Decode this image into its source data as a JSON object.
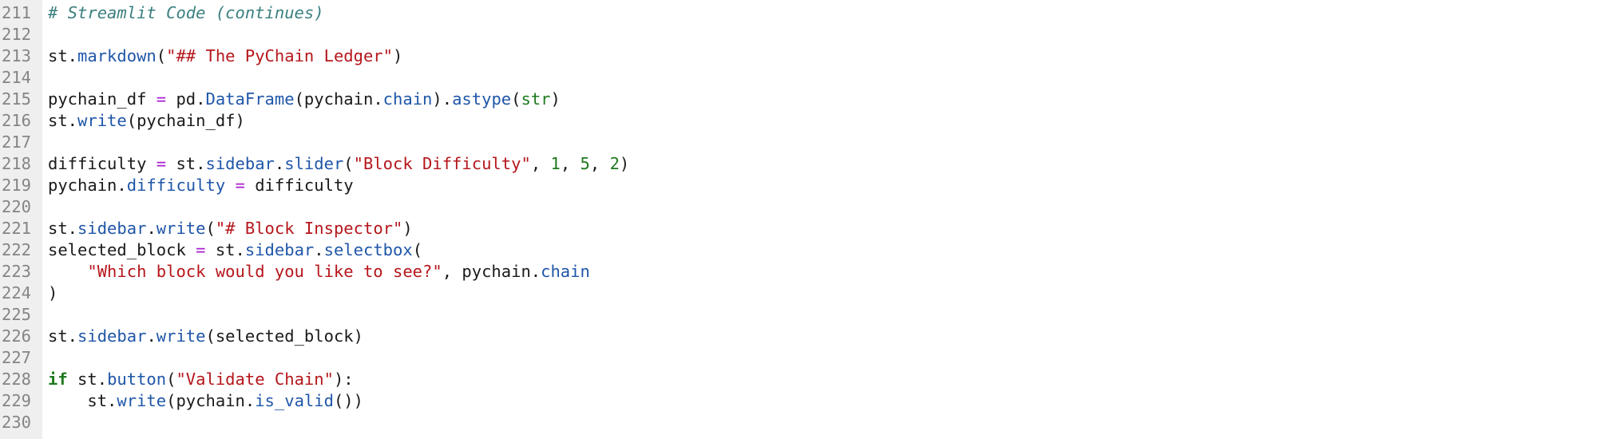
{
  "editor": {
    "lines": [
      {
        "number": "211",
        "tokens": [
          {
            "t": "# Streamlit Code (continues)",
            "k": "comment"
          }
        ]
      },
      {
        "number": "212",
        "tokens": []
      },
      {
        "number": "213",
        "tokens": [
          {
            "t": "st.",
            "k": "default"
          },
          {
            "t": "markdown",
            "k": "attr"
          },
          {
            "t": "(",
            "k": "default"
          },
          {
            "t": "\"## The PyChain Ledger\"",
            "k": "string"
          },
          {
            "t": ")",
            "k": "default"
          }
        ]
      },
      {
        "number": "214",
        "tokens": []
      },
      {
        "number": "215",
        "tokens": [
          {
            "t": "pychain_df ",
            "k": "default"
          },
          {
            "t": "=",
            "k": "op"
          },
          {
            "t": " pd.",
            "k": "default"
          },
          {
            "t": "DataFrame",
            "k": "attr"
          },
          {
            "t": "(pychain.",
            "k": "default"
          },
          {
            "t": "chain",
            "k": "attr"
          },
          {
            "t": ").",
            "k": "default"
          },
          {
            "t": "astype",
            "k": "attr"
          },
          {
            "t": "(",
            "k": "default"
          },
          {
            "t": "str",
            "k": "builtin"
          },
          {
            "t": ")",
            "k": "default"
          }
        ]
      },
      {
        "number": "216",
        "tokens": [
          {
            "t": "st.",
            "k": "default"
          },
          {
            "t": "write",
            "k": "attr"
          },
          {
            "t": "(pychain_df)",
            "k": "default"
          }
        ]
      },
      {
        "number": "217",
        "tokens": []
      },
      {
        "number": "218",
        "tokens": [
          {
            "t": "difficulty ",
            "k": "default"
          },
          {
            "t": "=",
            "k": "op"
          },
          {
            "t": " st.",
            "k": "default"
          },
          {
            "t": "sidebar",
            "k": "attr"
          },
          {
            "t": ".",
            "k": "default"
          },
          {
            "t": "slider",
            "k": "attr"
          },
          {
            "t": "(",
            "k": "default"
          },
          {
            "t": "\"Block Difficulty\"",
            "k": "string"
          },
          {
            "t": ", ",
            "k": "default"
          },
          {
            "t": "1",
            "k": "number"
          },
          {
            "t": ", ",
            "k": "default"
          },
          {
            "t": "5",
            "k": "number"
          },
          {
            "t": ", ",
            "k": "default"
          },
          {
            "t": "2",
            "k": "number"
          },
          {
            "t": ")",
            "k": "default"
          }
        ]
      },
      {
        "number": "219",
        "tokens": [
          {
            "t": "pychain.",
            "k": "default"
          },
          {
            "t": "difficulty",
            "k": "attr"
          },
          {
            "t": " ",
            "k": "default"
          },
          {
            "t": "=",
            "k": "op"
          },
          {
            "t": " difficulty",
            "k": "default"
          }
        ]
      },
      {
        "number": "220",
        "tokens": []
      },
      {
        "number": "221",
        "tokens": [
          {
            "t": "st.",
            "k": "default"
          },
          {
            "t": "sidebar",
            "k": "attr"
          },
          {
            "t": ".",
            "k": "default"
          },
          {
            "t": "write",
            "k": "attr"
          },
          {
            "t": "(",
            "k": "default"
          },
          {
            "t": "\"# Block Inspector\"",
            "k": "string"
          },
          {
            "t": ")",
            "k": "default"
          }
        ]
      },
      {
        "number": "222",
        "tokens": [
          {
            "t": "selected_block ",
            "k": "default"
          },
          {
            "t": "=",
            "k": "op"
          },
          {
            "t": " st.",
            "k": "default"
          },
          {
            "t": "sidebar",
            "k": "attr"
          },
          {
            "t": ".",
            "k": "default"
          },
          {
            "t": "selectbox",
            "k": "attr"
          },
          {
            "t": "(",
            "k": "default"
          }
        ]
      },
      {
        "number": "223",
        "tokens": [
          {
            "t": "    ",
            "k": "default"
          },
          {
            "t": "\"Which block would you like to see?\"",
            "k": "string"
          },
          {
            "t": ", pychain.",
            "k": "default"
          },
          {
            "t": "chain",
            "k": "attr"
          }
        ]
      },
      {
        "number": "224",
        "tokens": [
          {
            "t": ")",
            "k": "default"
          }
        ]
      },
      {
        "number": "225",
        "tokens": []
      },
      {
        "number": "226",
        "tokens": [
          {
            "t": "st.",
            "k": "default"
          },
          {
            "t": "sidebar",
            "k": "attr"
          },
          {
            "t": ".",
            "k": "default"
          },
          {
            "t": "write",
            "k": "attr"
          },
          {
            "t": "(selected_block)",
            "k": "default"
          }
        ]
      },
      {
        "number": "227",
        "tokens": []
      },
      {
        "number": "228",
        "tokens": [
          {
            "t": "if",
            "k": "keyword"
          },
          {
            "t": " st.",
            "k": "default"
          },
          {
            "t": "button",
            "k": "attr"
          },
          {
            "t": "(",
            "k": "default"
          },
          {
            "t": "\"Validate Chain\"",
            "k": "string"
          },
          {
            "t": "):",
            "k": "default"
          }
        ]
      },
      {
        "number": "229",
        "tokens": [
          {
            "t": "    st.",
            "k": "default"
          },
          {
            "t": "write",
            "k": "attr"
          },
          {
            "t": "(pychain.",
            "k": "default"
          },
          {
            "t": "is_valid",
            "k": "attr"
          },
          {
            "t": "())",
            "k": "default"
          }
        ]
      },
      {
        "number": "230",
        "tokens": []
      }
    ]
  }
}
